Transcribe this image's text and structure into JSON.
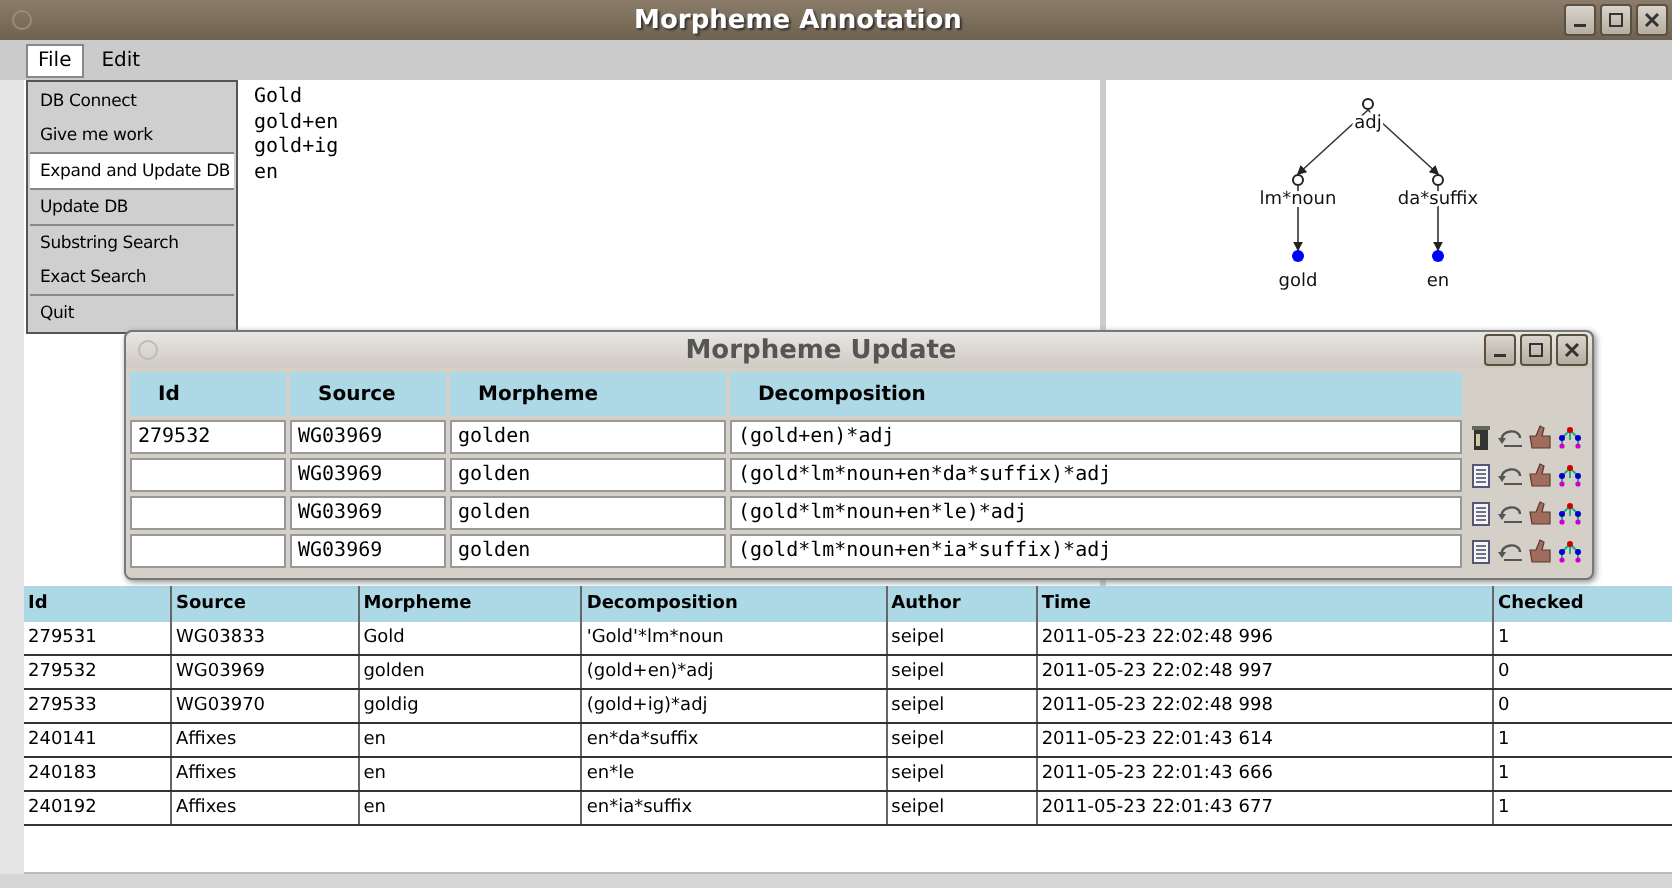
{
  "window": {
    "title": "Morpheme Annotation"
  },
  "menubar": [
    {
      "label": "File",
      "selected": true
    },
    {
      "label": "Edit",
      "selected": false
    }
  ],
  "file_menu": [
    {
      "label": "DB Connect",
      "selected": false,
      "divider_above": false
    },
    {
      "label": "Give me work",
      "selected": false,
      "divider_above": false
    },
    {
      "label": "Expand and Update DB",
      "selected": true,
      "divider_above": true
    },
    {
      "label": "Update DB",
      "selected": false,
      "divider_above": true
    },
    {
      "label": "Substring Search",
      "selected": false,
      "divider_above": true
    },
    {
      "label": "Exact Search",
      "selected": false,
      "divider_above": false
    },
    {
      "label": "Quit",
      "selected": false,
      "divider_above": true
    }
  ],
  "text_pane": {
    "lines": [
      "Gold",
      "gold+en",
      "gold+ig",
      "en"
    ]
  },
  "tree": {
    "label": "adj",
    "children": [
      {
        "label": "lm*noun",
        "children": [
          {
            "label": "gold"
          }
        ]
      },
      {
        "label": "da*suffix",
        "children": [
          {
            "label": "en"
          }
        ]
      }
    ]
  },
  "dialog": {
    "title": "Morpheme Update",
    "columns": [
      "Id",
      "Source",
      "Morpheme",
      "Decomposition"
    ],
    "rows": [
      {
        "id": "279532",
        "source": "WG03969",
        "morpheme": "golden",
        "decomposition": "(gold+en)*adj",
        "kind": "stored"
      },
      {
        "source": "WG03969",
        "morpheme": "golden",
        "decomposition": "(gold*lm*noun+en*da*suffix)*adj",
        "kind": "new"
      },
      {
        "source": "WG03969",
        "morpheme": "golden",
        "decomposition": "(gold*lm*noun+en*le)*adj",
        "kind": "new"
      },
      {
        "source": "WG03969",
        "morpheme": "golden",
        "decomposition": "(gold*lm*noun+en*ia*suffix)*adj",
        "kind": "new"
      }
    ]
  },
  "table": {
    "columns": [
      "Id",
      "Source",
      "Morpheme",
      "Decomposition",
      "Author",
      "Time",
      "Checked"
    ],
    "rows": [
      [
        "279531",
        "WG03833",
        "Gold",
        "'Gold'*lm*noun",
        "seipel",
        "2011-05-23 22:02:48 996",
        "1"
      ],
      [
        "279532",
        "WG03969",
        "golden",
        "(gold+en)*adj",
        "seipel",
        "2011-05-23 22:02:48 997",
        "0"
      ],
      [
        "279533",
        "WG03970",
        "goldig",
        "(gold+ig)*adj",
        "seipel",
        "2011-05-23 22:02:48 998",
        "0"
      ],
      [
        "240141",
        "Affixes",
        "en",
        "en*da*suffix",
        "seipel",
        "2011-05-23 22:01:43 614",
        "1"
      ],
      [
        "240183",
        "Affixes",
        "en",
        "en*le",
        "seipel",
        "2011-05-23 22:01:43 666",
        "1"
      ],
      [
        "240192",
        "Affixes",
        "en",
        "en*ia*suffix",
        "seipel",
        "2011-05-23 22:01:43 677",
        "1"
      ]
    ]
  }
}
